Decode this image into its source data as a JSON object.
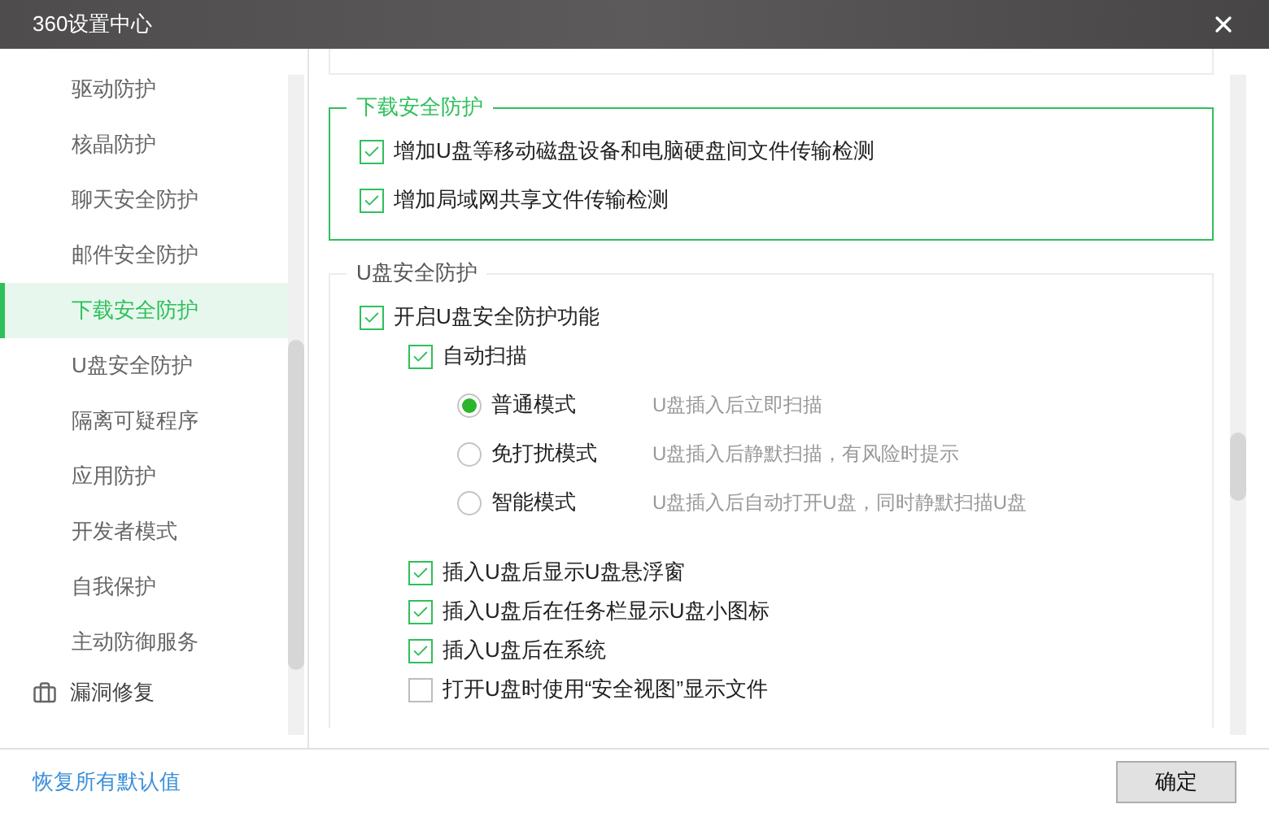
{
  "window": {
    "title": "360设置中心"
  },
  "sidebar": {
    "items": [
      {
        "label": "驱动防护",
        "selected": false,
        "kind": "item"
      },
      {
        "label": "核晶防护",
        "selected": false,
        "kind": "item"
      },
      {
        "label": "聊天安全防护",
        "selected": false,
        "kind": "item"
      },
      {
        "label": "邮件安全防护",
        "selected": false,
        "kind": "item"
      },
      {
        "label": "下载安全防护",
        "selected": true,
        "kind": "item"
      },
      {
        "label": "U盘安全防护",
        "selected": false,
        "kind": "item"
      },
      {
        "label": "隔离可疑程序",
        "selected": false,
        "kind": "item"
      },
      {
        "label": "应用防护",
        "selected": false,
        "kind": "item"
      },
      {
        "label": "开发者模式",
        "selected": false,
        "kind": "item"
      },
      {
        "label": "自我保护",
        "selected": false,
        "kind": "item"
      },
      {
        "label": "主动防御服务",
        "selected": false,
        "kind": "item"
      },
      {
        "label": "漏洞修复",
        "selected": false,
        "kind": "section"
      }
    ]
  },
  "sections": [
    {
      "title": "下载安全防护",
      "highlighted": true,
      "options": [
        {
          "kind": "checkbox",
          "label": "增加U盘等移动磁盘设备和电脑硬盘间文件传输检测",
          "checked": true
        },
        {
          "kind": "checkbox",
          "label": "增加局域网共享文件传输检测",
          "checked": true
        }
      ]
    },
    {
      "title": "U盘安全防护",
      "highlighted": false,
      "options": [
        {
          "kind": "checkbox",
          "label": "开启U盘安全防护功能",
          "checked": true,
          "children": [
            {
              "kind": "checkbox",
              "label": "自动扫描",
              "checked": true,
              "children": [
                {
                  "kind": "radio",
                  "label": "普通模式",
                  "description": "U盘插入后立即扫描",
                  "selected": true
                },
                {
                  "kind": "radio",
                  "label": "免打扰模式",
                  "description": "U盘插入后静默扫描，有风险时提示",
                  "selected": false
                },
                {
                  "kind": "radio",
                  "label": "智能模式",
                  "description": "U盘插入后自动打开U盘，同时静默扫描U盘",
                  "selected": false
                }
              ]
            },
            {
              "kind": "checkbox",
              "label": "插入U盘后显示U盘悬浮窗",
              "checked": true
            },
            {
              "kind": "checkbox",
              "label": "插入U盘后在任务栏显示U盘小图标",
              "checked": true
            },
            {
              "kind": "checkbox",
              "label": "插入U盘后在系统",
              "checked": true
            },
            {
              "kind": "checkbox",
              "label": "打开U盘时使用“安全视图”显示文件",
              "checked": false
            }
          ]
        }
      ]
    }
  ],
  "footer": {
    "reset_link": "恢复所有默认值",
    "ok_button": "确定"
  }
}
